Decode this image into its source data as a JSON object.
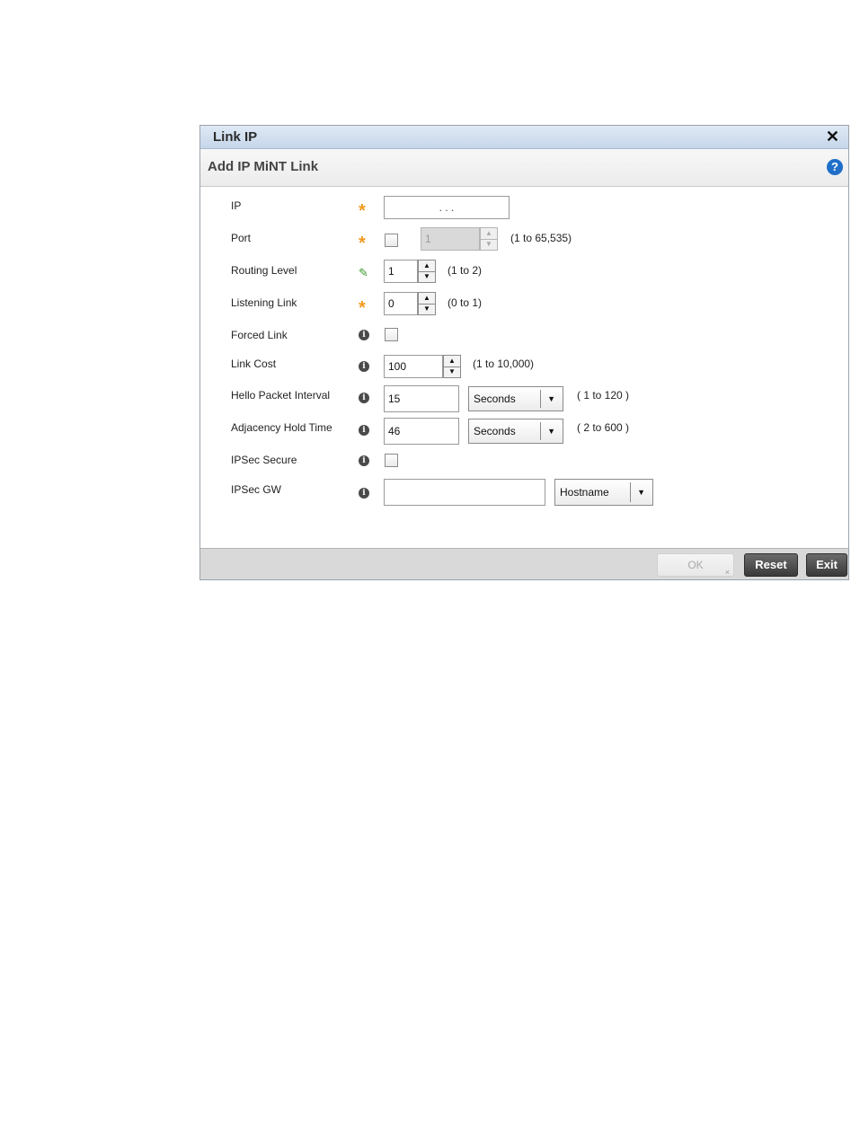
{
  "dialog": {
    "title": "Link IP",
    "subtitle": "Add IP MiNT Link"
  },
  "fields": {
    "ip": {
      "label": "IP",
      "value": ". . ."
    },
    "port": {
      "label": "Port",
      "value": "1",
      "range": "(1 to 65,535)"
    },
    "routing_level": {
      "label": "Routing Level",
      "value": "1",
      "range": "(1 to 2)"
    },
    "listening_link": {
      "label": "Listening Link",
      "value": "0",
      "range": "(0 to 1)"
    },
    "forced_link": {
      "label": "Forced Link"
    },
    "link_cost": {
      "label": "Link Cost",
      "value": "100",
      "range": "(1 to 10,000)"
    },
    "hello_packet_interval": {
      "label": "Hello Packet Interval",
      "value": "15",
      "unit": "Seconds",
      "range": "( 1 to 120 )"
    },
    "adjacency_hold_time": {
      "label": "Adjacency Hold Time",
      "value": "46",
      "unit": "Seconds",
      "range": "( 2 to 600 )"
    },
    "ipsec_secure": {
      "label": "IPSec Secure"
    },
    "ipsec_gw": {
      "label": "IPSec GW",
      "value": "",
      "type": "Hostname"
    }
  },
  "footer": {
    "ok_label": "OK",
    "reset_label": "Reset",
    "exit_label": "Exit"
  },
  "icons": {
    "close": "close-icon",
    "help": "help-icon",
    "required": "required-star-icon",
    "edited": "pencil-icon",
    "info": "info-icon"
  },
  "colors": {
    "titlebar": "#c6d6ea",
    "required_star": "#f29a1f",
    "help": "#1f6fc9",
    "pencil": "#3c9a2f"
  }
}
